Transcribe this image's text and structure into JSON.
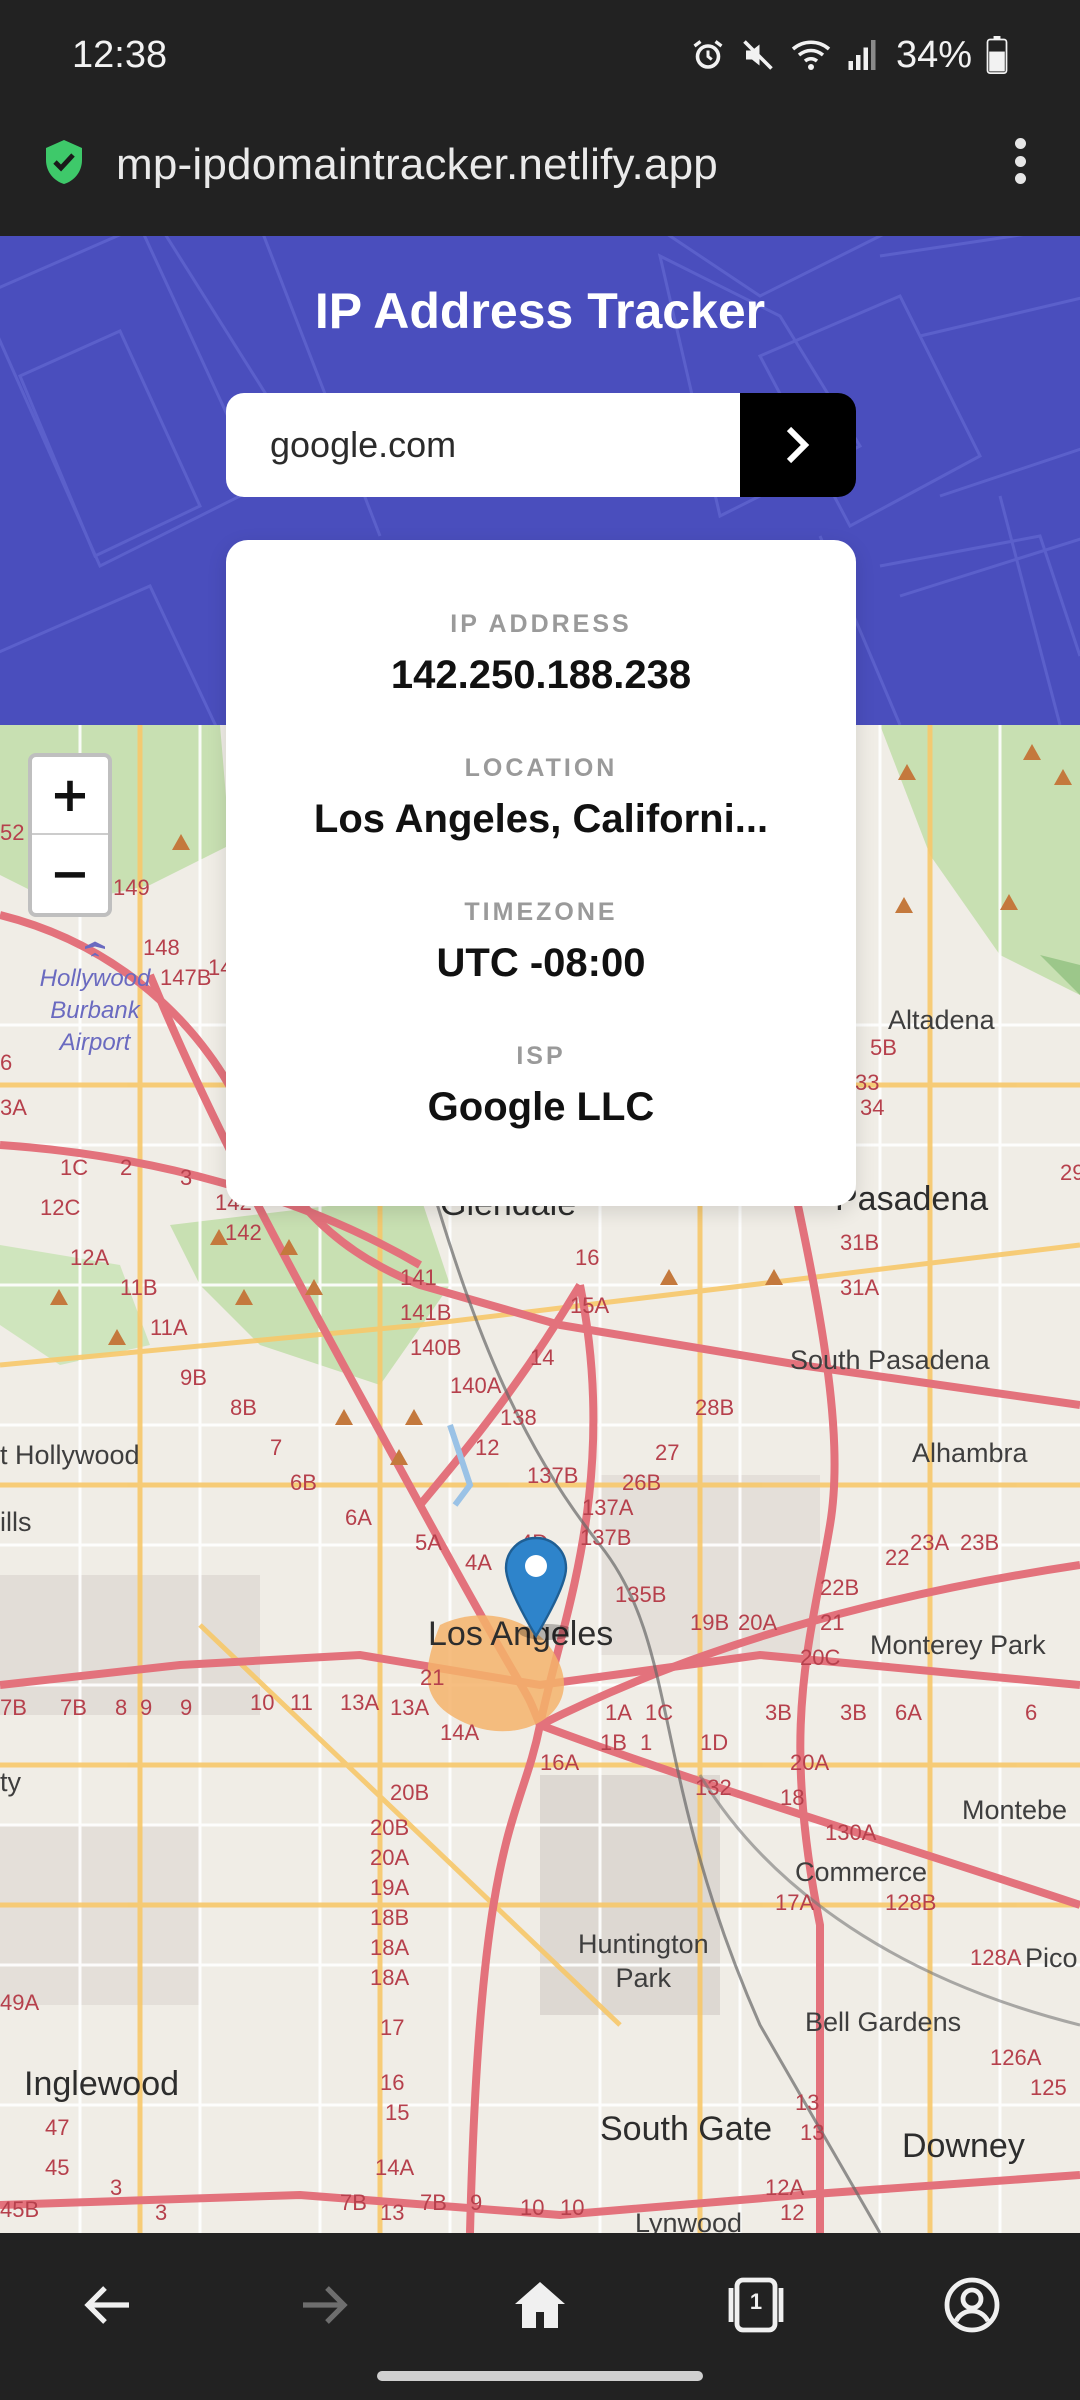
{
  "status_bar": {
    "time": "12:38",
    "battery": "34%",
    "icons": [
      "alarm-icon",
      "mute-icon",
      "wifi-icon",
      "signal-icon",
      "battery-icon"
    ]
  },
  "browser": {
    "url": "mp-ipdomaintracker.netlify.app",
    "secure_icon": "shield-check-icon",
    "menu_icon": "more-vert-icon"
  },
  "header": {
    "title": "IP Address Tracker",
    "background_color": "#4a4ebd"
  },
  "search": {
    "value": "google.com",
    "submit_icon": "chevron-right-icon"
  },
  "info": {
    "ip_label": "IP ADDRESS",
    "ip_value": "142.250.188.238",
    "location_label": "LOCATION",
    "location_value": "Los Angeles, Californi...",
    "timezone_label": "TIMEZONE",
    "timezone_value": "UTC -08:00",
    "isp_label": "ISP",
    "isp_value": "Google LLC"
  },
  "map": {
    "zoom_in": "+",
    "zoom_out": "−",
    "marker_color": "#2e84cb",
    "labels": {
      "hollywood_burbank_airport": "Hollywood\nBurbank\nAirport",
      "altadena": "Altadena",
      "glendale": "Glendale",
      "pasadena": "Pasadena",
      "south_pasadena": "South Pasadena",
      "west_hollywood": "t Hollywood",
      "alhambra": "Alhambra",
      "los_angeles": "Los Angeles",
      "monterey_park": "Monterey Park",
      "montebello": "Montebe",
      "commerce": "Commerce",
      "huntington_park": "Huntington\nPark",
      "pico": "Pico",
      "bell_gardens": "Bell Gardens",
      "inglewood": "Inglewood",
      "south_gate": "South Gate",
      "downey": "Downey",
      "lynwood": "Lynwood",
      "hills": "ills",
      "city": "ty"
    }
  },
  "nav": {
    "back_icon": "back-arrow-icon",
    "forward_icon": "forward-arrow-icon",
    "home_icon": "home-icon",
    "tabs_icon": "tabs-icon",
    "tabs_count": "1",
    "account_icon": "account-icon"
  }
}
